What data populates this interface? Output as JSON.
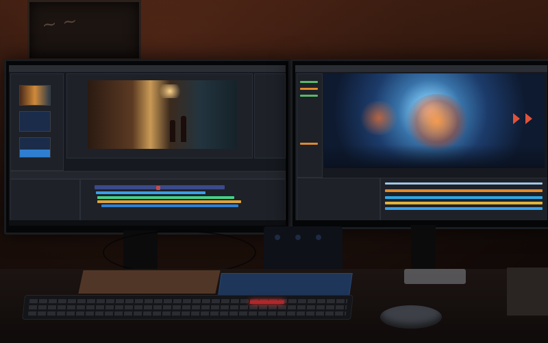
{
  "scene": {
    "left_monitor": {
      "preview_palette": [
        "#2b1a12",
        "#c99a56",
        "#23343f"
      ],
      "track_colors": [
        "#3aa0e6",
        "#46d08a",
        "#e0a33a",
        "#c44b4b",
        "#7b6be2"
      ]
    },
    "right_monitor": {
      "preview_palette": [
        "#ffffff",
        "#6fb6e6",
        "#e0722c",
        "#0e1a30"
      ],
      "track_colors": [
        "#e08a2c",
        "#2ea8e6",
        "#e0b43a",
        "#3aa0e6"
      ]
    },
    "keyboard_accent_color": "#b3262a"
  }
}
